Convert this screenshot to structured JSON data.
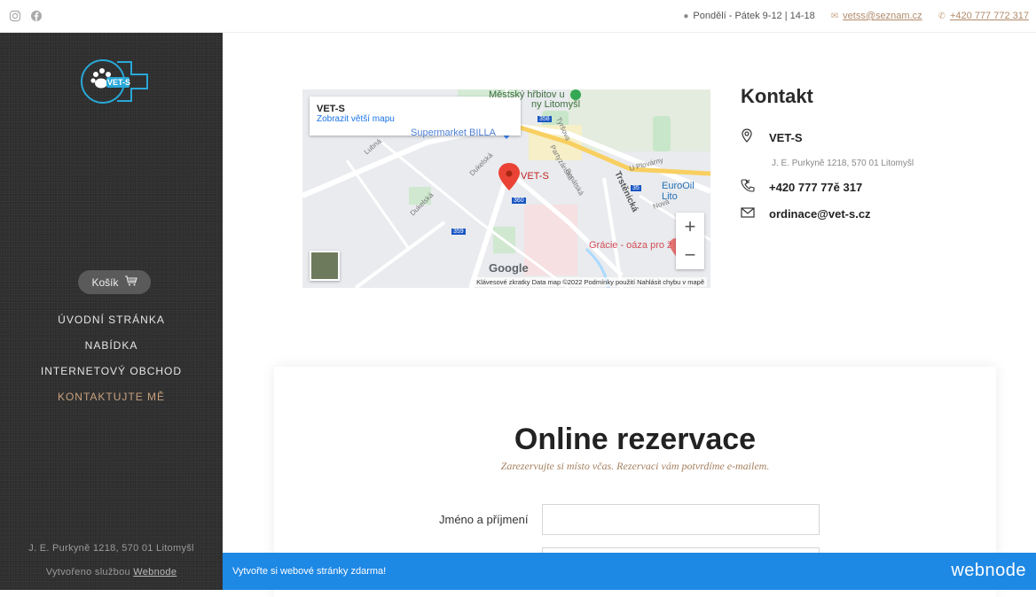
{
  "topbar": {
    "social_icons": [
      "instagram-icon",
      "facebook-icon"
    ],
    "hours": "Pondělí - Pátek 9-12 | 14-18",
    "email": "vetss@seznam.cz",
    "phone": "+420 777 772 317"
  },
  "sidebar": {
    "logo_text": "VET-S",
    "cart_label": "Košík",
    "nav": [
      {
        "label": "ÚVODNÍ STRÁNKA",
        "active": false
      },
      {
        "label": "NABÍDKA",
        "active": false
      },
      {
        "label": "INTERNETOVÝ OBCHOD",
        "active": false
      },
      {
        "label": "KONTAKTUJTE MĚ",
        "active": true
      }
    ],
    "address": "J. E. Purkyně 1218, 570 01 Litomyšl",
    "created_prefix": "Vytvořeno službou",
    "created_link": "Webnode"
  },
  "map": {
    "card_title": "VET-S",
    "card_link": "Zobrazit větší mapu",
    "pin_label": "VET-S",
    "labels": {
      "cemetery": "Městský hřbitov u",
      "cemetery2": "ny Litomyšl",
      "supermarket": "Supermarket BILLA",
      "euro_oil": "EuroOil Lito",
      "gracie": "Grácie - oáza pro ž",
      "trstenicka": "Trstěnická",
      "nova": "Nová",
      "u_plovarny": "U Plovárny",
      "dukelska": "Dukelská",
      "dukelska2": "Dukelská",
      "partyzanska": "Partyzánská",
      "lubna": "Lubná",
      "tyrsova": "Tyršova",
      "benatska": "Benátská",
      "r358": "358",
      "r360": "360",
      "r359": "359",
      "r35": "35"
    },
    "zoom_in": "+",
    "zoom_out": "−",
    "google": "Google",
    "footer": "Klávesové zkratky   Data map ©2022   Podmínky použití   Nahlásit chybu v mapě"
  },
  "contact": {
    "title": "Kontakt",
    "name": "VET-S",
    "address": "J. E. Purkyně 1218, 570 01 Litomyšl",
    "phone": "+420 777 77ě 317",
    "email": "ordinace@vet-s.cz"
  },
  "reservation": {
    "title": "Online rezervace",
    "subtitle": "Zarezervujte si místo včas. Rezervaci vám potvrdíme e-mailem.",
    "name_label": "Jméno a příjmení",
    "name_value": ""
  },
  "banner": {
    "text": "Vytvořte si webové stránky zdarma!",
    "brand": "webnode"
  }
}
